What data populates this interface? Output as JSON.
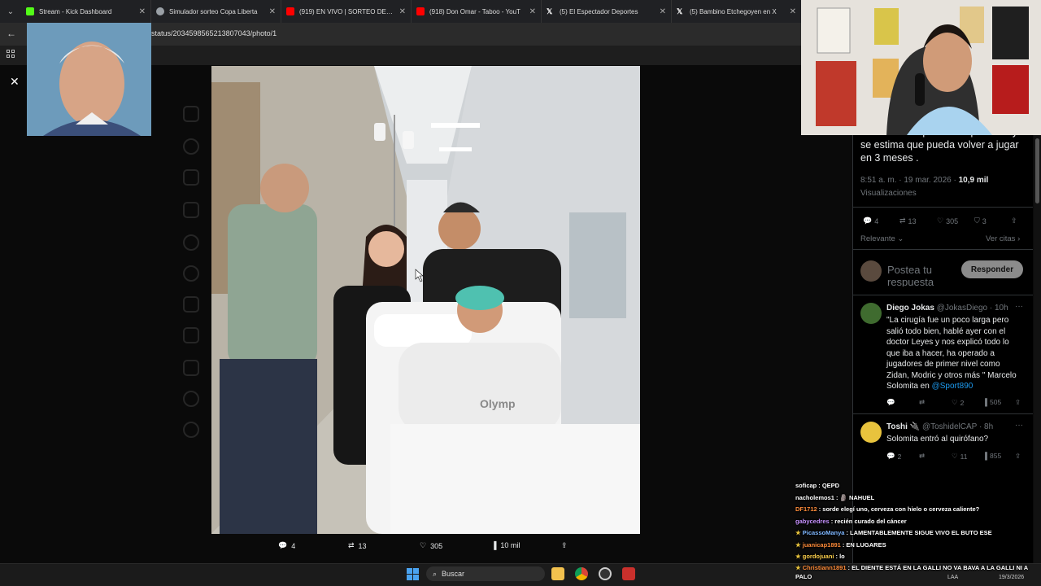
{
  "browser": {
    "tabs": [
      {
        "title": "Stream - Kick Dashboard",
        "color": "#53fc18"
      },
      {
        "title": "Simulador sorteo Copa Liberta",
        "color": "#9aa0a6"
      },
      {
        "title": "(919) EN VIVO | SORTEO DE LA",
        "color": "#ff0000"
      },
      {
        "title": "(918) Don Omar - Taboo - YouT",
        "color": "#ff0000"
      },
      {
        "title": "(5) El Espectador Deportes",
        "color": "#ffffff"
      },
      {
        "title": "(5) Bambino Etchegoyen en X",
        "color": "#ffffff"
      }
    ],
    "url": "status/2034598565213807043/photo/1"
  },
  "media_bar": {
    "replies": "4",
    "reposts": "13",
    "likes": "305",
    "views": "10 mil"
  },
  "tweet": {
    "text": "arranca la etapa de recuperación y se estima que pueda volver a jugar en 3 meses .",
    "time": "8:51 a. m. · 19 mar. 2026 ·",
    "views_count": "10,9 mil",
    "views_label": "Visualizaciones",
    "actions": {
      "replies": "4",
      "reposts": "13",
      "likes": "305",
      "bookmarks": "3"
    },
    "sort_label": "Relevante",
    "quotes_label": "Ver citas",
    "reply_placeholder": "Postea tu respuesta",
    "reply_button": "Responder"
  },
  "comments": [
    {
      "name": "Diego Jokas",
      "handle": "@JokasDiego · 10h",
      "text": "\"La cirugía fue un poco larga pero salió todo bien, hablé ayer con el doctor Leyes y nos explicó todo lo que iba a hacer, ha operado a jugadores de primer nivel como Zidan, Modric y otros más \" Marcelo Solomita en",
      "link": "@Sport890",
      "likes": "2",
      "views": "505"
    },
    {
      "name": "Toshi 🔌",
      "handle": "@ToshidelCAP · 8h",
      "text": "Solomita entró al quirófano?",
      "replies": "2",
      "likes": "11",
      "views": "855"
    }
  ],
  "chat": [
    {
      "user": "soficap",
      "color": "#ffffff",
      "msg": ": QEPD"
    },
    {
      "user": "nacholemos1",
      "color": "#ffffff",
      "msg": ": 🗿 NAHUEL"
    },
    {
      "user": "DF1712",
      "color": "#ff8c3a",
      "msg": ": sorde elegí uno, cerveza con hielo o cerveza caliente?"
    },
    {
      "user": "gabycedres",
      "color": "#c792ff",
      "msg": ": recién curado del cáncer"
    },
    {
      "user": "PicassoManya",
      "color": "#7fb7ff",
      "msg": ": LAMENTABLEMENTE SIGUE VIVO EL BUTO ESE"
    },
    {
      "user": "juanicap1891",
      "color": "#ff8c3a",
      "msg": ": EN LUGARES"
    },
    {
      "user": "gordojuani",
      "color": "#ffd24d",
      "msg": ": lo"
    },
    {
      "user": "Christiann1891",
      "color": "#ff8c3a",
      "msg": ": EL DIENTE ESTÁ EN LA GALLI NO VA BAVA A LA GALLI NI A PALO"
    }
  ],
  "taskbar": {
    "search": "Buscar",
    "lang": "LAA",
    "date": "19/3/2026"
  }
}
